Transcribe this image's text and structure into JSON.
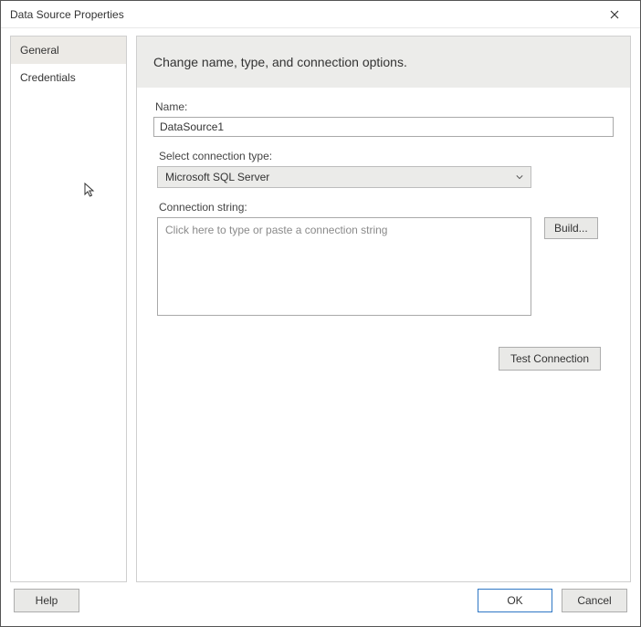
{
  "window": {
    "title": "Data Source Properties"
  },
  "sidebar": {
    "items": [
      {
        "label": "General",
        "selected": true
      },
      {
        "label": "Credentials",
        "selected": false
      }
    ]
  },
  "main": {
    "heading": "Change name, type, and connection options.",
    "name_label": "Name:",
    "name_value": "DataSource1",
    "conn_type_label": "Select connection type:",
    "conn_type_value": "Microsoft SQL Server",
    "conn_string_label": "Connection string:",
    "conn_string_value": "",
    "conn_string_placeholder": "Click here to type or paste a connection string",
    "build_label": "Build...",
    "test_label": "Test Connection"
  },
  "footer": {
    "help": "Help",
    "ok": "OK",
    "cancel": "Cancel"
  }
}
